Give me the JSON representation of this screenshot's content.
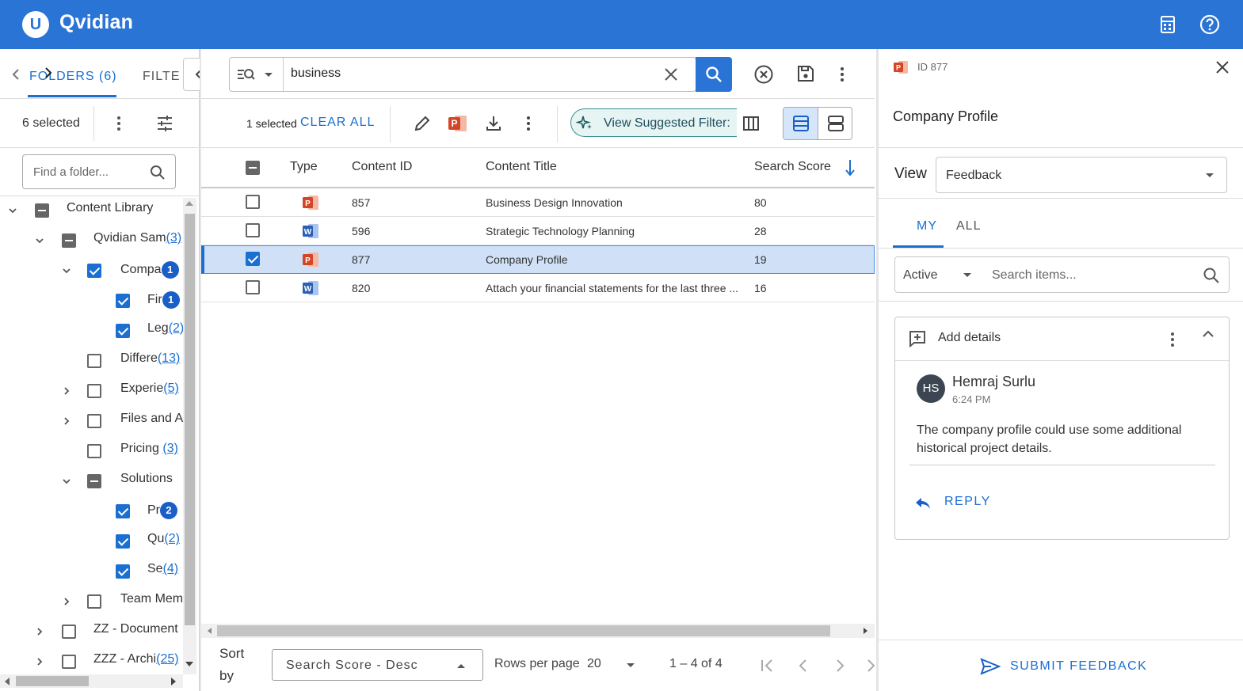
{
  "app": {
    "brand": "Qvidian",
    "logo_letter": "U",
    "accent": "#2a74d6"
  },
  "left": {
    "tabs": {
      "folders": "FOLDERS (6)",
      "filters": "FILTE"
    },
    "selected_text": "6 selected",
    "find_placeholder": "Find a folder...",
    "tree": [
      {
        "label": "Content Library",
        "state": "partial"
      },
      {
        "label": "Qvidian Sam",
        "count": "(3)",
        "state": "partial"
      },
      {
        "label": "Compa",
        "badge": "1",
        "state": "checked"
      },
      {
        "label": "Fir",
        "badge": "1",
        "state": "checked"
      },
      {
        "label": "Leg",
        "count": "(2)",
        "state": "checked"
      },
      {
        "label": "Differe",
        "count": "(13)",
        "state": "unchecked"
      },
      {
        "label": "Experie",
        "count": "(5)",
        "state": "unchecked"
      },
      {
        "label": "Files and A",
        "state": "unchecked"
      },
      {
        "label": "Pricing ",
        "count": "(3)",
        "state": "unchecked"
      },
      {
        "label": "Solutions",
        "state": "partial"
      },
      {
        "label": "Pr",
        "badge": "2",
        "state": "checked"
      },
      {
        "label": "Qu",
        "count": "(2)",
        "state": "checked"
      },
      {
        "label": "Se",
        "count": "(4)",
        "state": "checked"
      },
      {
        "label": "Team Mem",
        "state": "unchecked"
      },
      {
        "label": "ZZ - Document",
        "state": "unchecked"
      },
      {
        "label": "ZZZ - Archi",
        "count": "(25)",
        "state": "unchecked"
      }
    ]
  },
  "center": {
    "search_value": "business",
    "selected_text": "1 selected",
    "clear_all": "CLEAR ALL",
    "view_suggested": "View Suggested Filter:",
    "columns": {
      "type": "Type",
      "content_id": "Content ID",
      "content_title": "Content Title",
      "search_score": "Search Score"
    },
    "rows": [
      {
        "type": "ppt",
        "id": "857",
        "title": "Business Design Innovation",
        "score": "80",
        "checked": false
      },
      {
        "type": "word",
        "id": "596",
        "title": "Strategic Technology Planning",
        "score": "28",
        "checked": false
      },
      {
        "type": "ppt",
        "id": "877",
        "title": "Company Profile",
        "score": "19",
        "checked": true
      },
      {
        "type": "word",
        "id": "820",
        "title": "Attach your financial statements for the last three ...",
        "score": "16",
        "checked": false
      }
    ],
    "footer": {
      "sort_label_1": "Sort",
      "sort_label_2": "by",
      "sort_value": "Search Score - Desc",
      "rows_per_page_label": "Rows per page",
      "rows_per_page_value": "20",
      "pagination": "1 – 4 of 4"
    }
  },
  "right": {
    "id_label": "ID 877",
    "title": "Company Profile",
    "view_label": "View",
    "view_value": "Feedback",
    "tabs": {
      "my": "MY",
      "all": "ALL"
    },
    "status_value": "Active",
    "search_placeholder": "Search items...",
    "card": {
      "header": "Add details",
      "initials": "HS",
      "author": "Hemraj Surlu",
      "time": "6:24 PM",
      "comment": "The company profile could use some additional historical project details.",
      "reply": "REPLY"
    },
    "submit": "SUBMIT FEEDBACK"
  }
}
